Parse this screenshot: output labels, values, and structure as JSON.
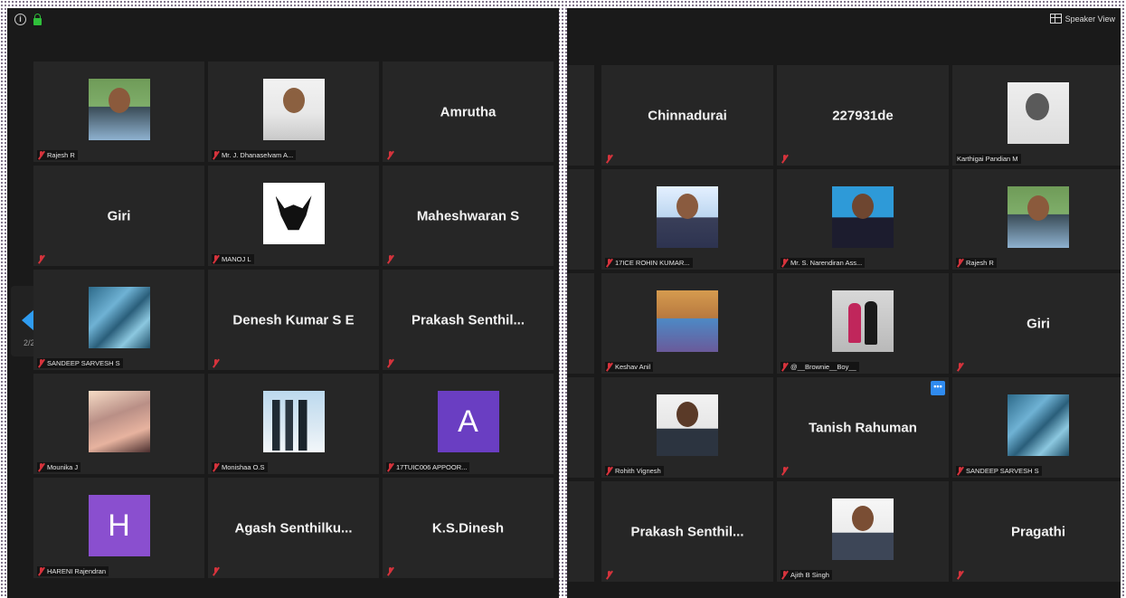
{
  "left": {
    "page_indicator": "2/2",
    "tiles": [
      {
        "name": "",
        "label": "Rajesh R",
        "photo": "p-person"
      },
      {
        "name": "",
        "label": "Mr. J. Dhanaselvam A...",
        "photo": "p-white"
      },
      {
        "name": "Amrutha",
        "label": "",
        "photo": ""
      },
      {
        "name": "Giri",
        "label": "",
        "photo": ""
      },
      {
        "name": "",
        "label": "MANOJ L",
        "photo": "p-bull"
      },
      {
        "name": "Maheshwaran S",
        "label": "",
        "photo": ""
      },
      {
        "name": "",
        "label": "SANDEEP SARVESH S",
        "photo": "p-cubes"
      },
      {
        "name": "Denesh Kumar S E",
        "label": "",
        "photo": ""
      },
      {
        "name": "Prakash  Senthil...",
        "label": "",
        "photo": ""
      },
      {
        "name": "",
        "label": "Mounika J",
        "photo": "p-sunset"
      },
      {
        "name": "",
        "label": "Monishaa O.S",
        "photo": "p-penguin"
      },
      {
        "name": "",
        "label": "17TUIC006 APPOOR...",
        "letter": "A",
        "letter_color": "#6a3ec2"
      },
      {
        "name": "",
        "label": "HARENI Rajendran",
        "letter": "H",
        "letter_color": "#8a4fcf"
      },
      {
        "name": "Agash  Senthilku...",
        "label": "",
        "photo": ""
      },
      {
        "name": "K.S.Dinesh",
        "label": "",
        "photo": ""
      }
    ]
  },
  "right": {
    "speaker_view": "Speaker View",
    "tiles": [
      {
        "name": "Chinnadurai",
        "label": "",
        "photo": ""
      },
      {
        "name": "227931de",
        "label": "",
        "photo": ""
      },
      {
        "name": "",
        "label": "Karthigai Pandian M",
        "photo": "p-gray",
        "no_mic": true
      },
      {
        "name": "",
        "label": "17ICE ROHIN KUMAR...",
        "photo": "p-boy"
      },
      {
        "name": "",
        "label": "Mr. S. Narendiran Ass...",
        "photo": "p-formal"
      },
      {
        "name": "",
        "label": "Rajesh R",
        "photo": "p-person"
      },
      {
        "name": "",
        "label": "Keshav Anil",
        "photo": "p-kids"
      },
      {
        "name": "",
        "label": "@__Brownie__Boy__",
        "photo": "p-couple"
      },
      {
        "name": "Giri",
        "label": "",
        "photo": ""
      },
      {
        "name": "",
        "label": "Rohith Vignesh",
        "photo": "p-guy"
      },
      {
        "name": "Tanish Rahuman",
        "label": "",
        "photo": "",
        "more": true
      },
      {
        "name": "",
        "label": "SANDEEP SARVESH S",
        "photo": "p-cubes"
      },
      {
        "name": "Prakash  Senthil...",
        "label": "",
        "photo": ""
      },
      {
        "name": "",
        "label": "Ajith B Singh",
        "photo": "p-suit"
      },
      {
        "name": "Pragathi",
        "label": "",
        "photo": ""
      }
    ]
  }
}
